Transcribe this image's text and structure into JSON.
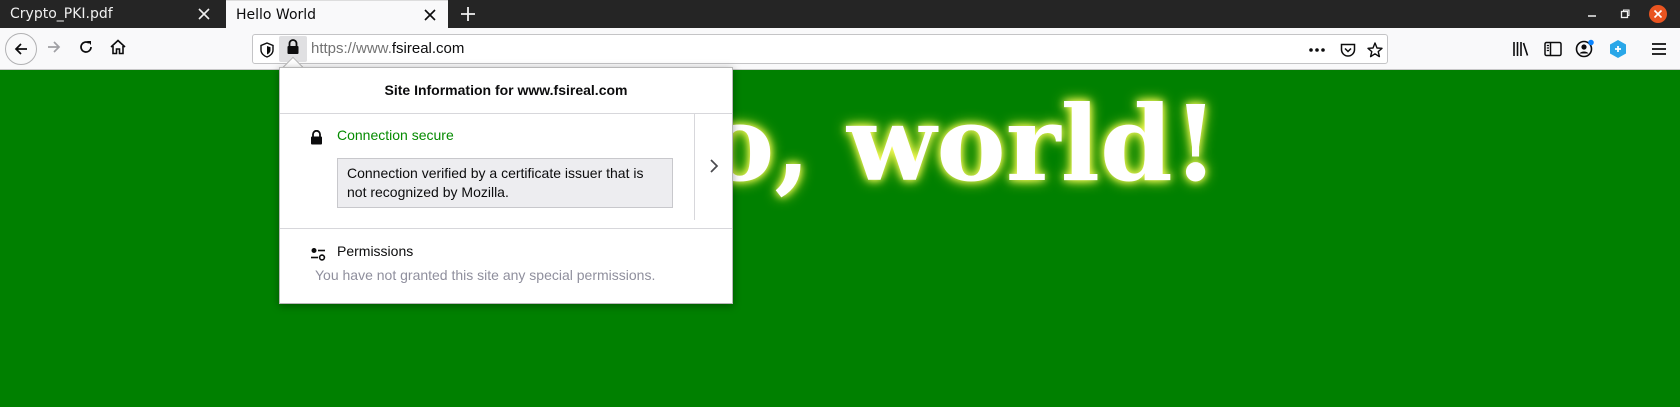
{
  "tabs": [
    {
      "label": "Crypto_PKI.pdf",
      "active": false
    },
    {
      "label": "Hello World",
      "active": true
    }
  ],
  "navbar": {
    "url_prefix": "https://www.",
    "url_domain": "fsireal.com"
  },
  "page": {
    "heading": "Hello, world!"
  },
  "popup": {
    "title": "Site Information for www.fsireal.com",
    "connection_label": "Connection secure",
    "connection_note": "Connection verified by a certificate issuer that is not recognized by Mozilla.",
    "permissions_label": "Permissions",
    "permissions_text": "You have not granted this site any special permissions."
  },
  "colors": {
    "page_background": "#008000",
    "connection_secure": "#058b00",
    "window_close": "#e95420"
  },
  "icons": [
    "tab-close-icon",
    "new-tab-icon",
    "minimize-icon",
    "restore-icon",
    "window-close-icon",
    "back-icon",
    "forward-icon",
    "reload-icon",
    "home-icon",
    "tracking-protection-icon",
    "lock-icon",
    "page-actions-icon",
    "pocket-icon",
    "bookmark-star-icon",
    "library-icon",
    "sidebar-icon",
    "account-icon",
    "extension-icon",
    "menu-icon",
    "chevron-right-icon",
    "permissions-icon"
  ]
}
